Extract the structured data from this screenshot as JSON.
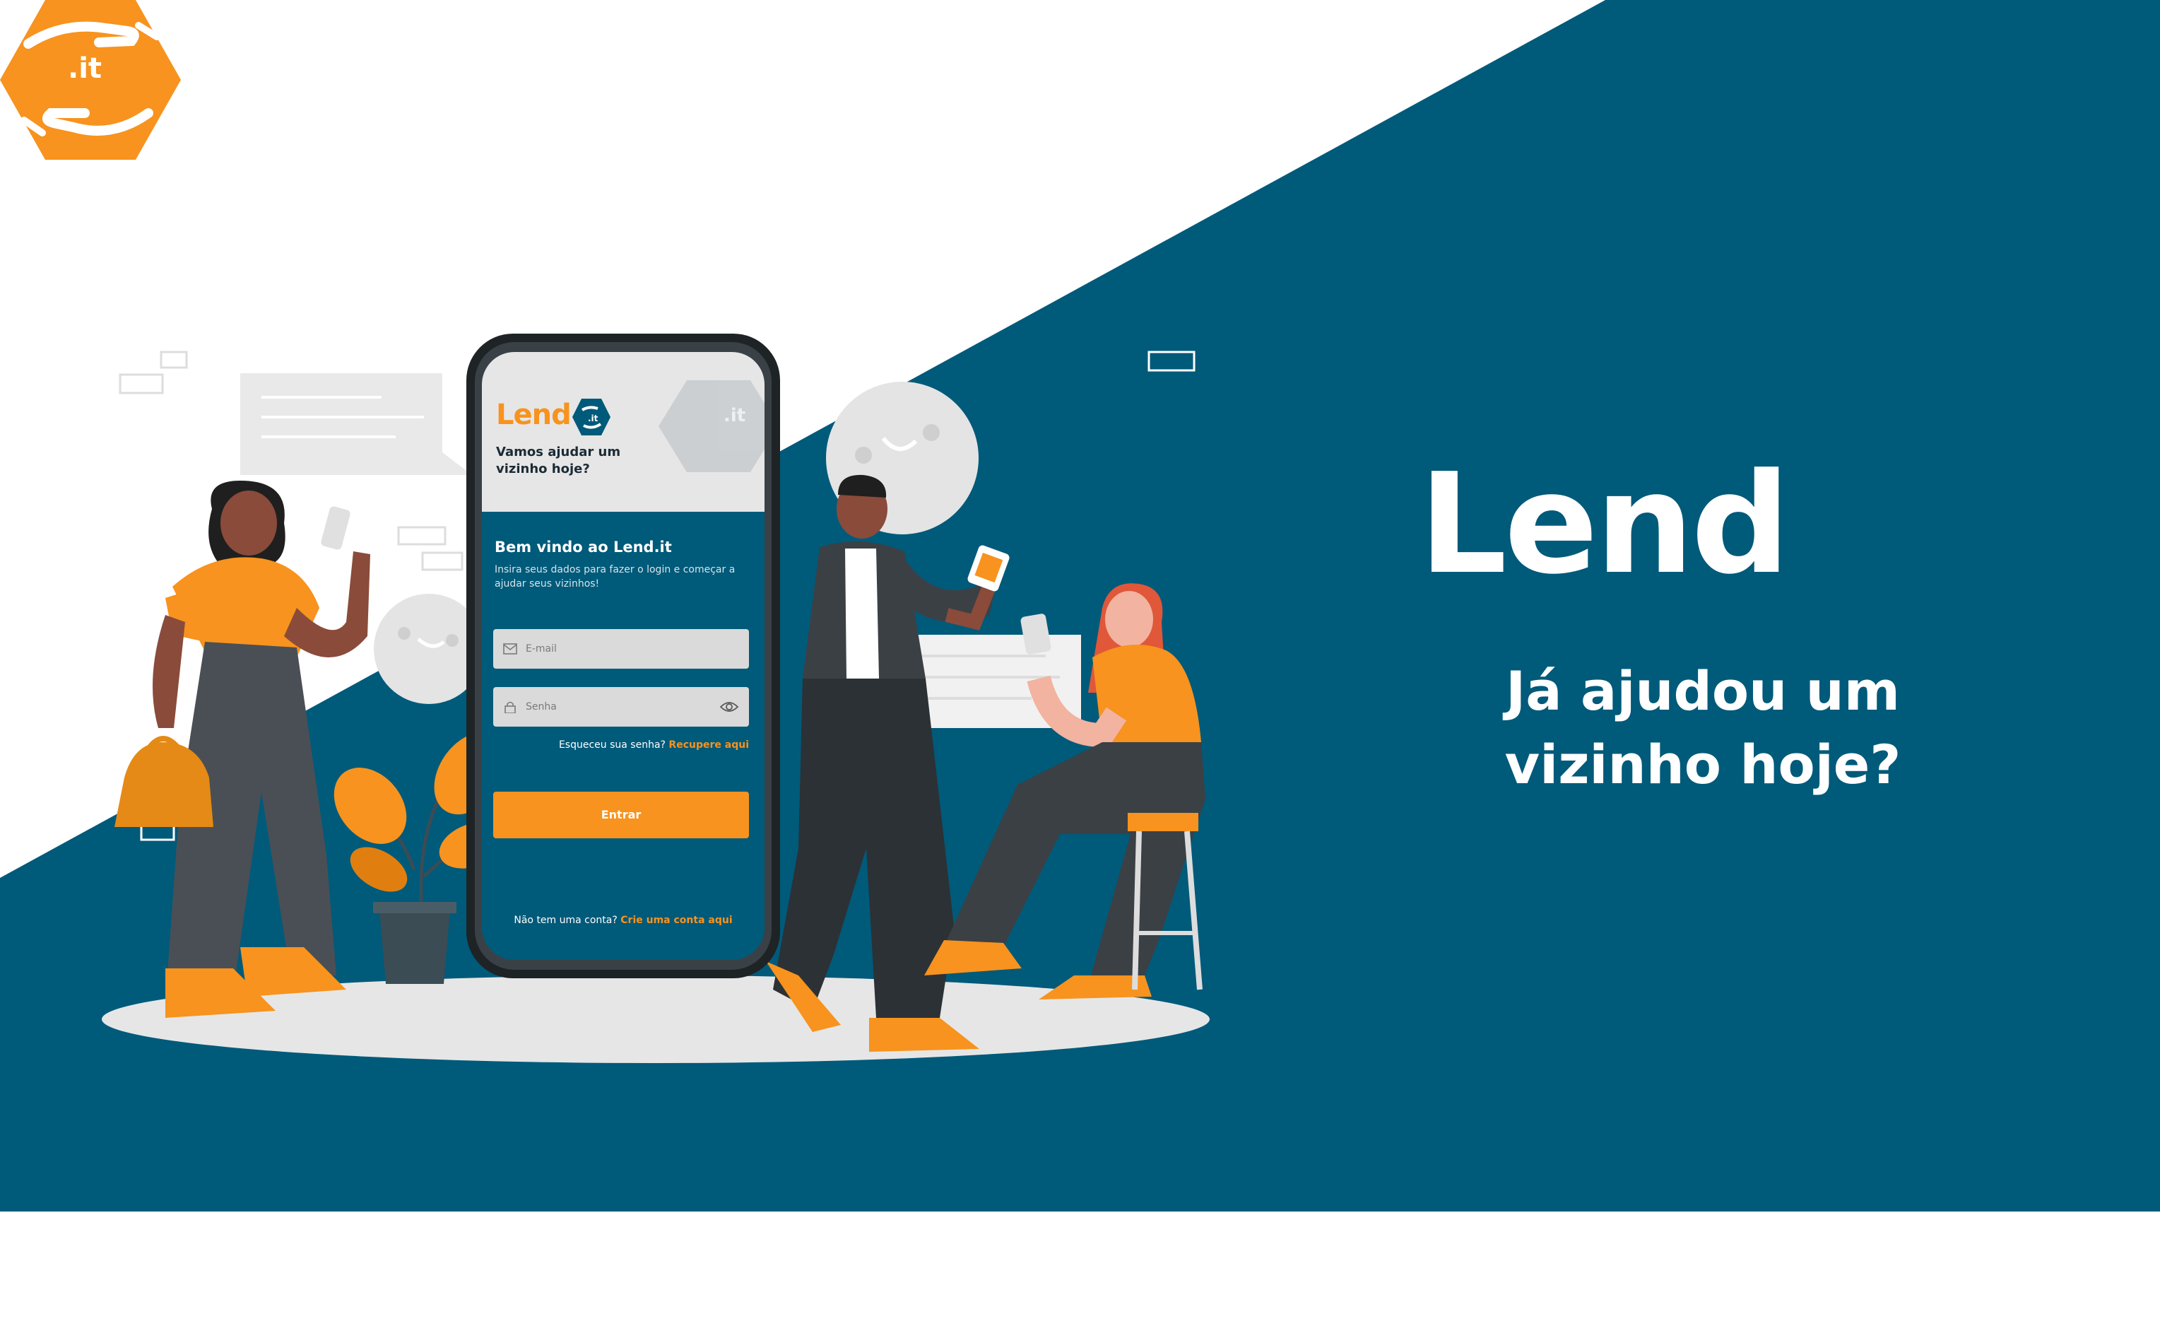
{
  "brand": {
    "name": "Lend",
    "badge_text": ".it",
    "tagline_line1": "Já ajudou um",
    "tagline_line2": "vizinho hoje?"
  },
  "phone": {
    "logo_text": "Lend",
    "logo_badge_text": ".it",
    "tagline": "Vamos ajudar um vizinho hoje?",
    "welcome_title": "Bem vindo ao Lend.it",
    "instructions": "Insira seus dados para fazer o login e começar a ajudar seus vizinhos!",
    "email_placeholder": "E-mail",
    "password_placeholder": "Senha",
    "forgot_text": "Esqueceu sua senha?",
    "forgot_link": "Recupere aqui",
    "login_button": "Entrar",
    "signup_text": "Não tem uma conta?",
    "signup_link": "Crie uma conta aqui"
  },
  "colors": {
    "primary_blue": "#005a7a",
    "accent_orange": "#f7931e",
    "light_gray": "#e6e6e6",
    "white": "#ffffff"
  },
  "icons": [
    "hands-hexagon-logo-icon",
    "mail-icon",
    "lock-icon",
    "eye-icon"
  ]
}
